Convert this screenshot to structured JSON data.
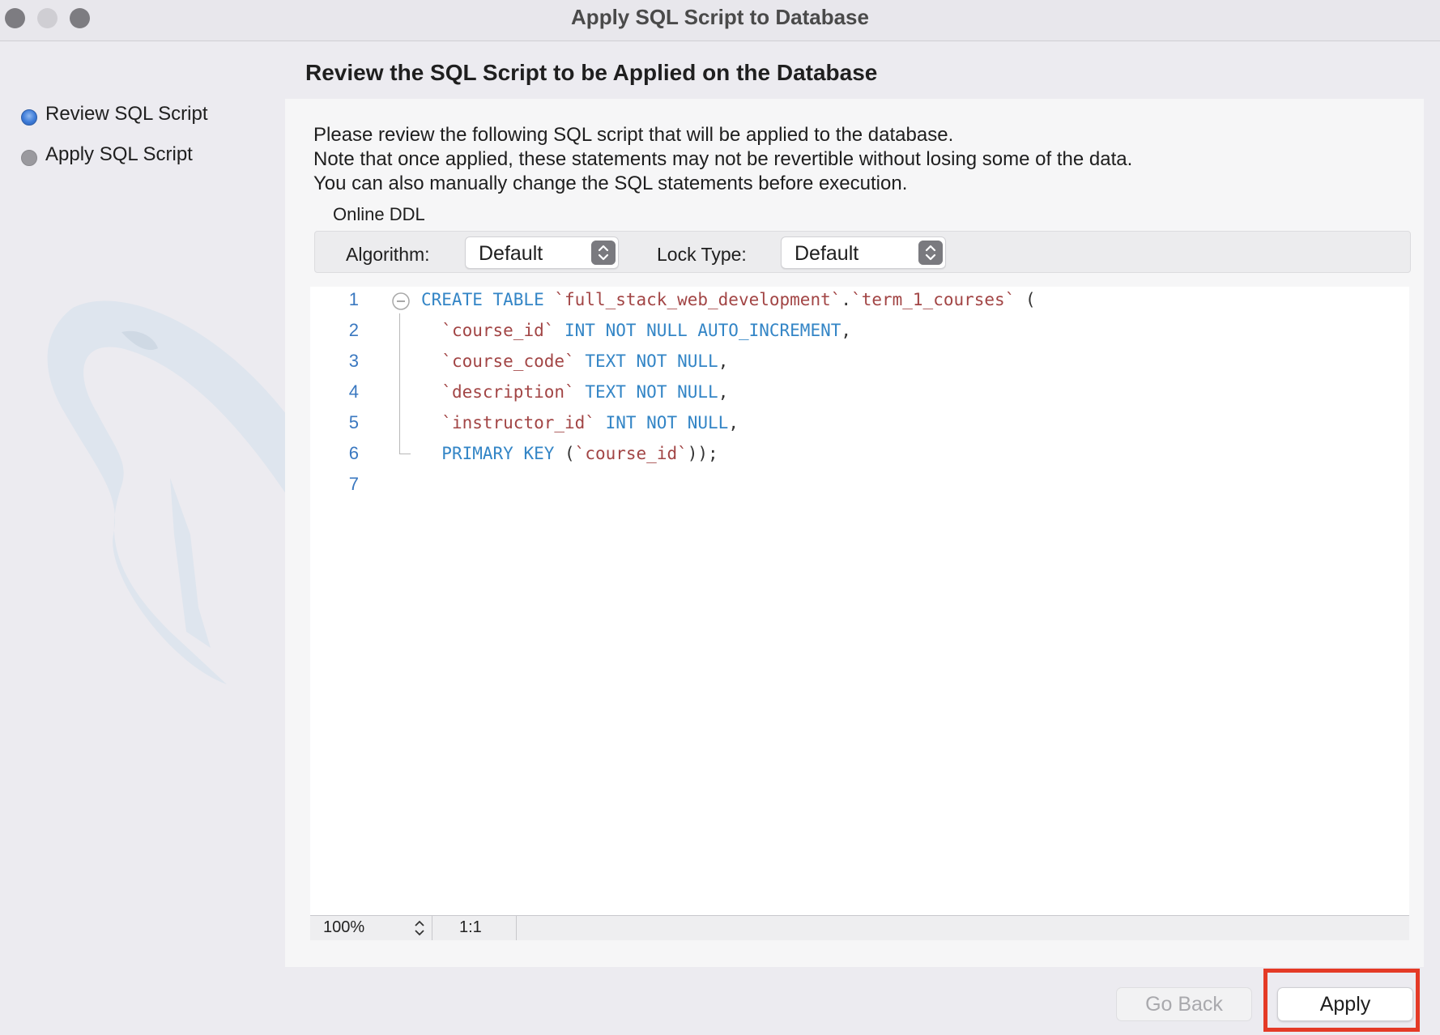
{
  "window": {
    "title": "Apply SQL Script to Database"
  },
  "steps": [
    {
      "label": "Review SQL Script",
      "state": "active"
    },
    {
      "label": "Apply SQL Script",
      "state": "inactive"
    }
  ],
  "heading": "Review the SQL Script to be Applied on the Database",
  "description": [
    "Please review the following SQL script that will be applied to the database.",
    "Note that once applied, these statements may not be revertible without losing some of the data.",
    "You can also manually change the SQL statements before execution."
  ],
  "online_ddl": {
    "label": "Online DDL",
    "algorithm_label": "Algorithm:",
    "algorithm_value": "Default",
    "lock_type_label": "Lock Type:",
    "lock_type_value": "Default"
  },
  "editor": {
    "line_numbers": [
      "1",
      "2",
      "3",
      "4",
      "5",
      "6",
      "7"
    ],
    "lines": [
      [
        {
          "t": "CREATE TABLE ",
          "c": "kw"
        },
        {
          "t": "`full_stack_web_development`",
          "c": "id"
        },
        {
          "t": ".",
          "c": "pl"
        },
        {
          "t": "`term_1_courses`",
          "c": "id"
        },
        {
          "t": " (",
          "c": "pl"
        }
      ],
      [
        {
          "t": "  ",
          "c": "pl"
        },
        {
          "t": "`course_id`",
          "c": "id"
        },
        {
          "t": " INT NOT NULL AUTO_INCREMENT",
          "c": "kw"
        },
        {
          "t": ",",
          "c": "pl"
        }
      ],
      [
        {
          "t": "  ",
          "c": "pl"
        },
        {
          "t": "`course_code`",
          "c": "id"
        },
        {
          "t": " TEXT NOT NULL",
          "c": "kw"
        },
        {
          "t": ",",
          "c": "pl"
        }
      ],
      [
        {
          "t": "  ",
          "c": "pl"
        },
        {
          "t": "`description`",
          "c": "id"
        },
        {
          "t": " TEXT NOT NULL",
          "c": "kw"
        },
        {
          "t": ",",
          "c": "pl"
        }
      ],
      [
        {
          "t": "  ",
          "c": "pl"
        },
        {
          "t": "`instructor_id`",
          "c": "id"
        },
        {
          "t": " INT NOT NULL",
          "c": "kw"
        },
        {
          "t": ",",
          "c": "pl"
        }
      ],
      [
        {
          "t": "  ",
          "c": "pl"
        },
        {
          "t": "PRIMARY KEY",
          "c": "kw"
        },
        {
          "t": " (",
          "c": "pl"
        },
        {
          "t": "`course_id`",
          "c": "id"
        },
        {
          "t": "));",
          "c": "pl"
        }
      ],
      []
    ],
    "zoom": "100%",
    "cursor_position": "1:1"
  },
  "buttons": {
    "go_back": "Go Back",
    "apply": "Apply"
  },
  "colors": {
    "keyword": "#3385c6",
    "identifier": "#a24545",
    "highlight": "#e43a26"
  }
}
